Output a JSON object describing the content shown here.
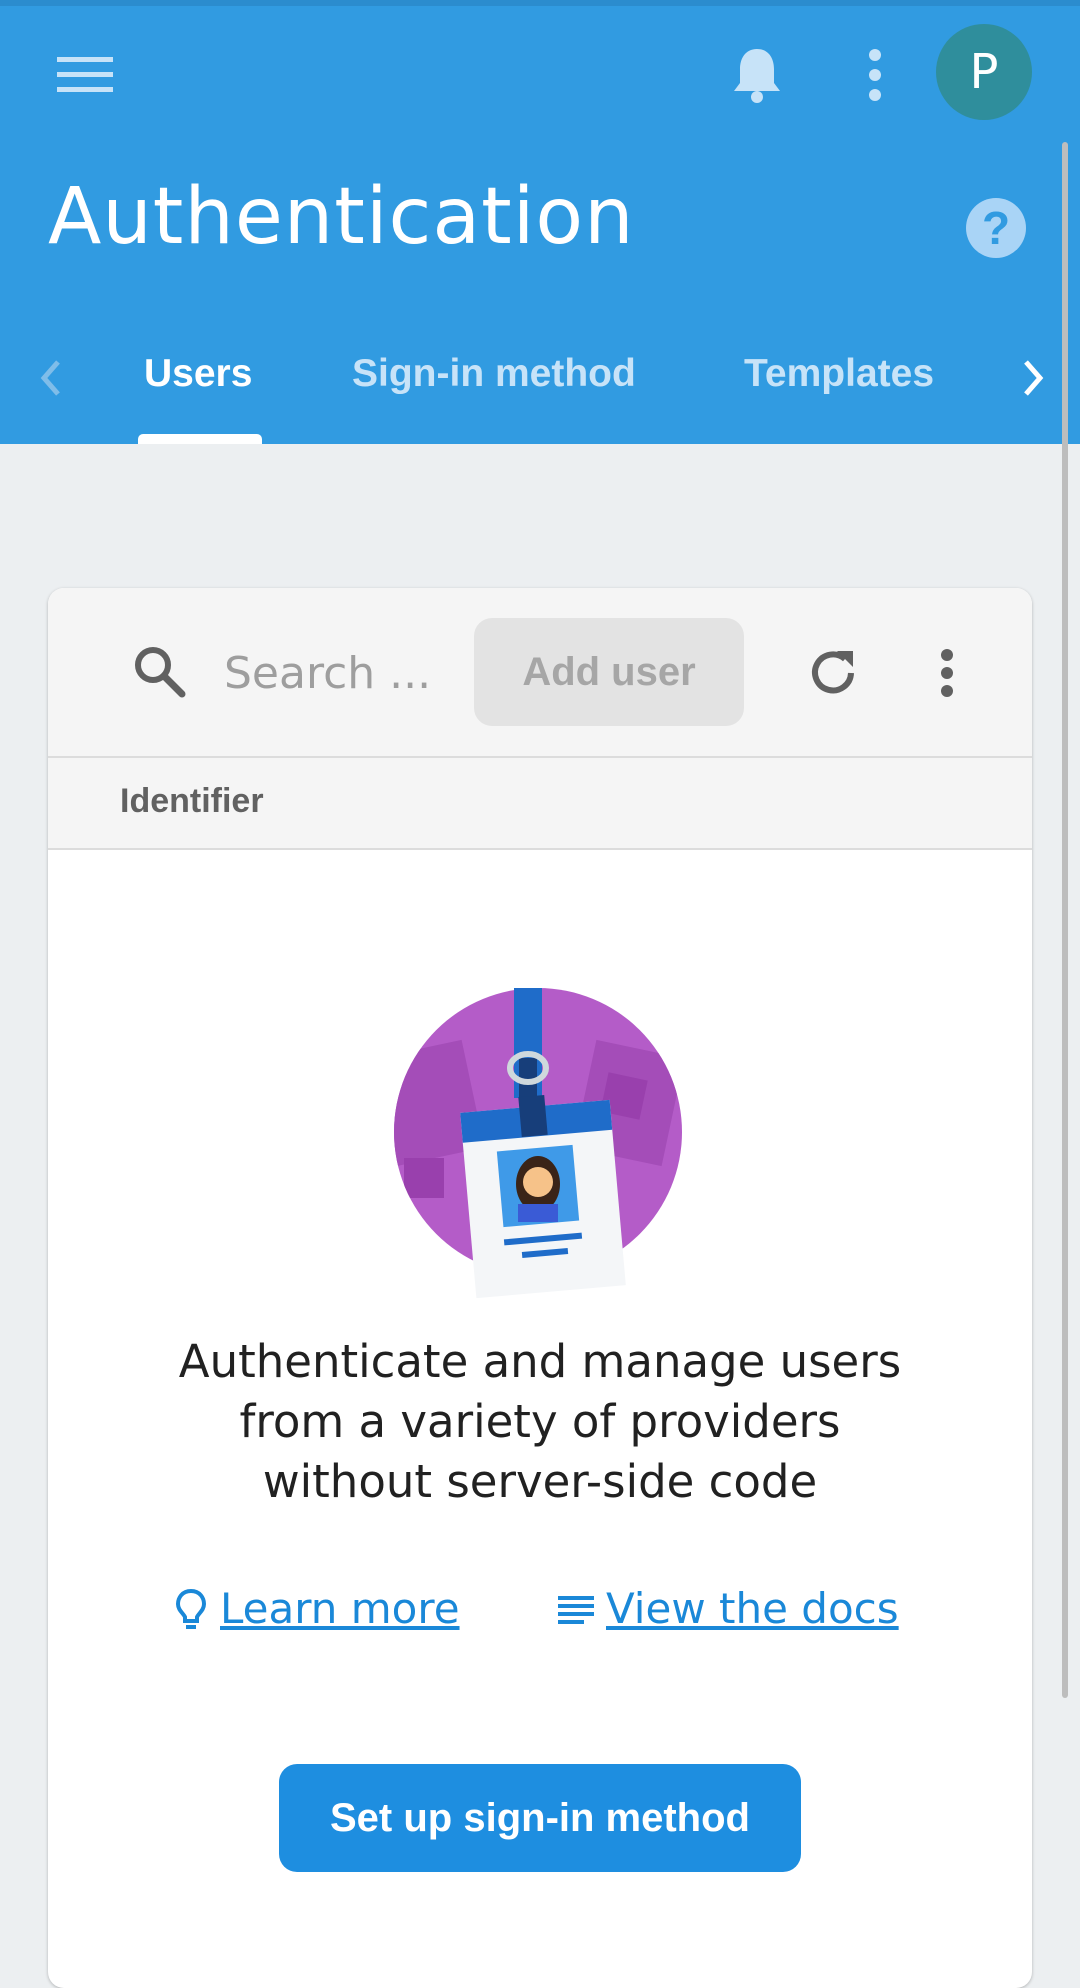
{
  "header": {
    "title": "Authentication",
    "avatar_initial": "P",
    "icons": {
      "menu": "menu-icon",
      "notifications": "bell-icon",
      "more": "more-vertical-icon",
      "help": "help-icon"
    }
  },
  "tabs": [
    {
      "label": "Users",
      "active": true
    },
    {
      "label": "Sign-in method",
      "active": false
    },
    {
      "label": "Templates",
      "active": false
    }
  ],
  "toolbar": {
    "search_placeholder": "Search ...",
    "add_user_label": "Add user"
  },
  "table": {
    "columns": [
      "Identifier"
    ]
  },
  "empty_state": {
    "message": "Authenticate and manage users from a variety of providers without server-side code",
    "learn_more_label": "Learn more",
    "docs_label": "View the docs",
    "setup_button_label": "Set up sign-in method"
  },
  "colors": {
    "primary": "#319be1",
    "accent_button": "#1e8ee0",
    "link": "#1a88d8",
    "avatar": "#2f8e9c",
    "illustration_bg": "#b45cc8"
  }
}
